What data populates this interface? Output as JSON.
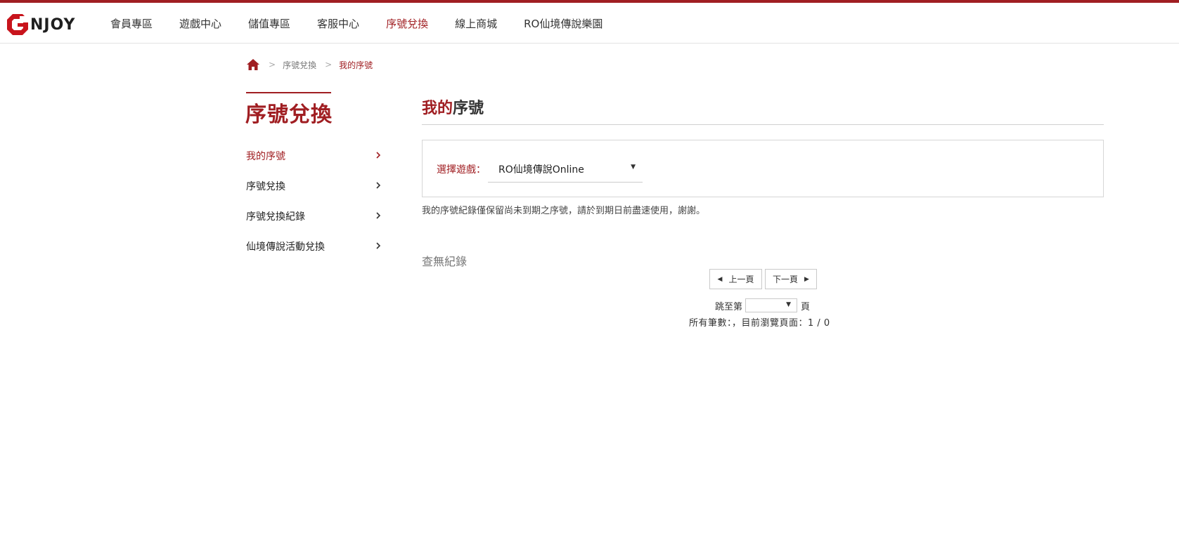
{
  "brand": {
    "logo_text": "NJOY",
    "accent_color": "#a01e22"
  },
  "nav": {
    "items": [
      {
        "label": "會員專區",
        "active": false
      },
      {
        "label": "遊戲中心",
        "active": false
      },
      {
        "label": "儲值專區",
        "active": false
      },
      {
        "label": "客服中心",
        "active": false
      },
      {
        "label": "序號兌換",
        "active": true
      },
      {
        "label": "線上商城",
        "active": false
      },
      {
        "label": "RO仙境傳說樂園",
        "active": false
      }
    ]
  },
  "breadcrumb": {
    "home_icon": "home-icon",
    "sep": ">",
    "items": [
      "序號兌換",
      "我的序號"
    ]
  },
  "sidebar": {
    "title": "序號兌換",
    "items": [
      {
        "label": "我的序號",
        "active": true
      },
      {
        "label": "序號兌換",
        "active": false
      },
      {
        "label": "序號兌換紀錄",
        "active": false
      },
      {
        "label": "仙境傳說活動兌換",
        "active": false
      }
    ],
    "arrow_icon": "chevron-right-icon"
  },
  "main": {
    "title_highlight": "我的",
    "title_rest": "序號",
    "game_select": {
      "label": "選擇遊戲：",
      "value": "RO仙境傳說Online"
    },
    "notice": "我的序號紀錄僅保留尚未到期之序號，請於到期日前盡速使用，謝謝。",
    "empty_message": "查無紀錄"
  },
  "pagination": {
    "prev_label": "上一頁",
    "next_label": "下一頁",
    "jump_prefix": "跳至第",
    "jump_suffix": "頁",
    "jump_value": "",
    "stats": "所有筆數：，目前瀏覽頁面：1 / 0"
  }
}
